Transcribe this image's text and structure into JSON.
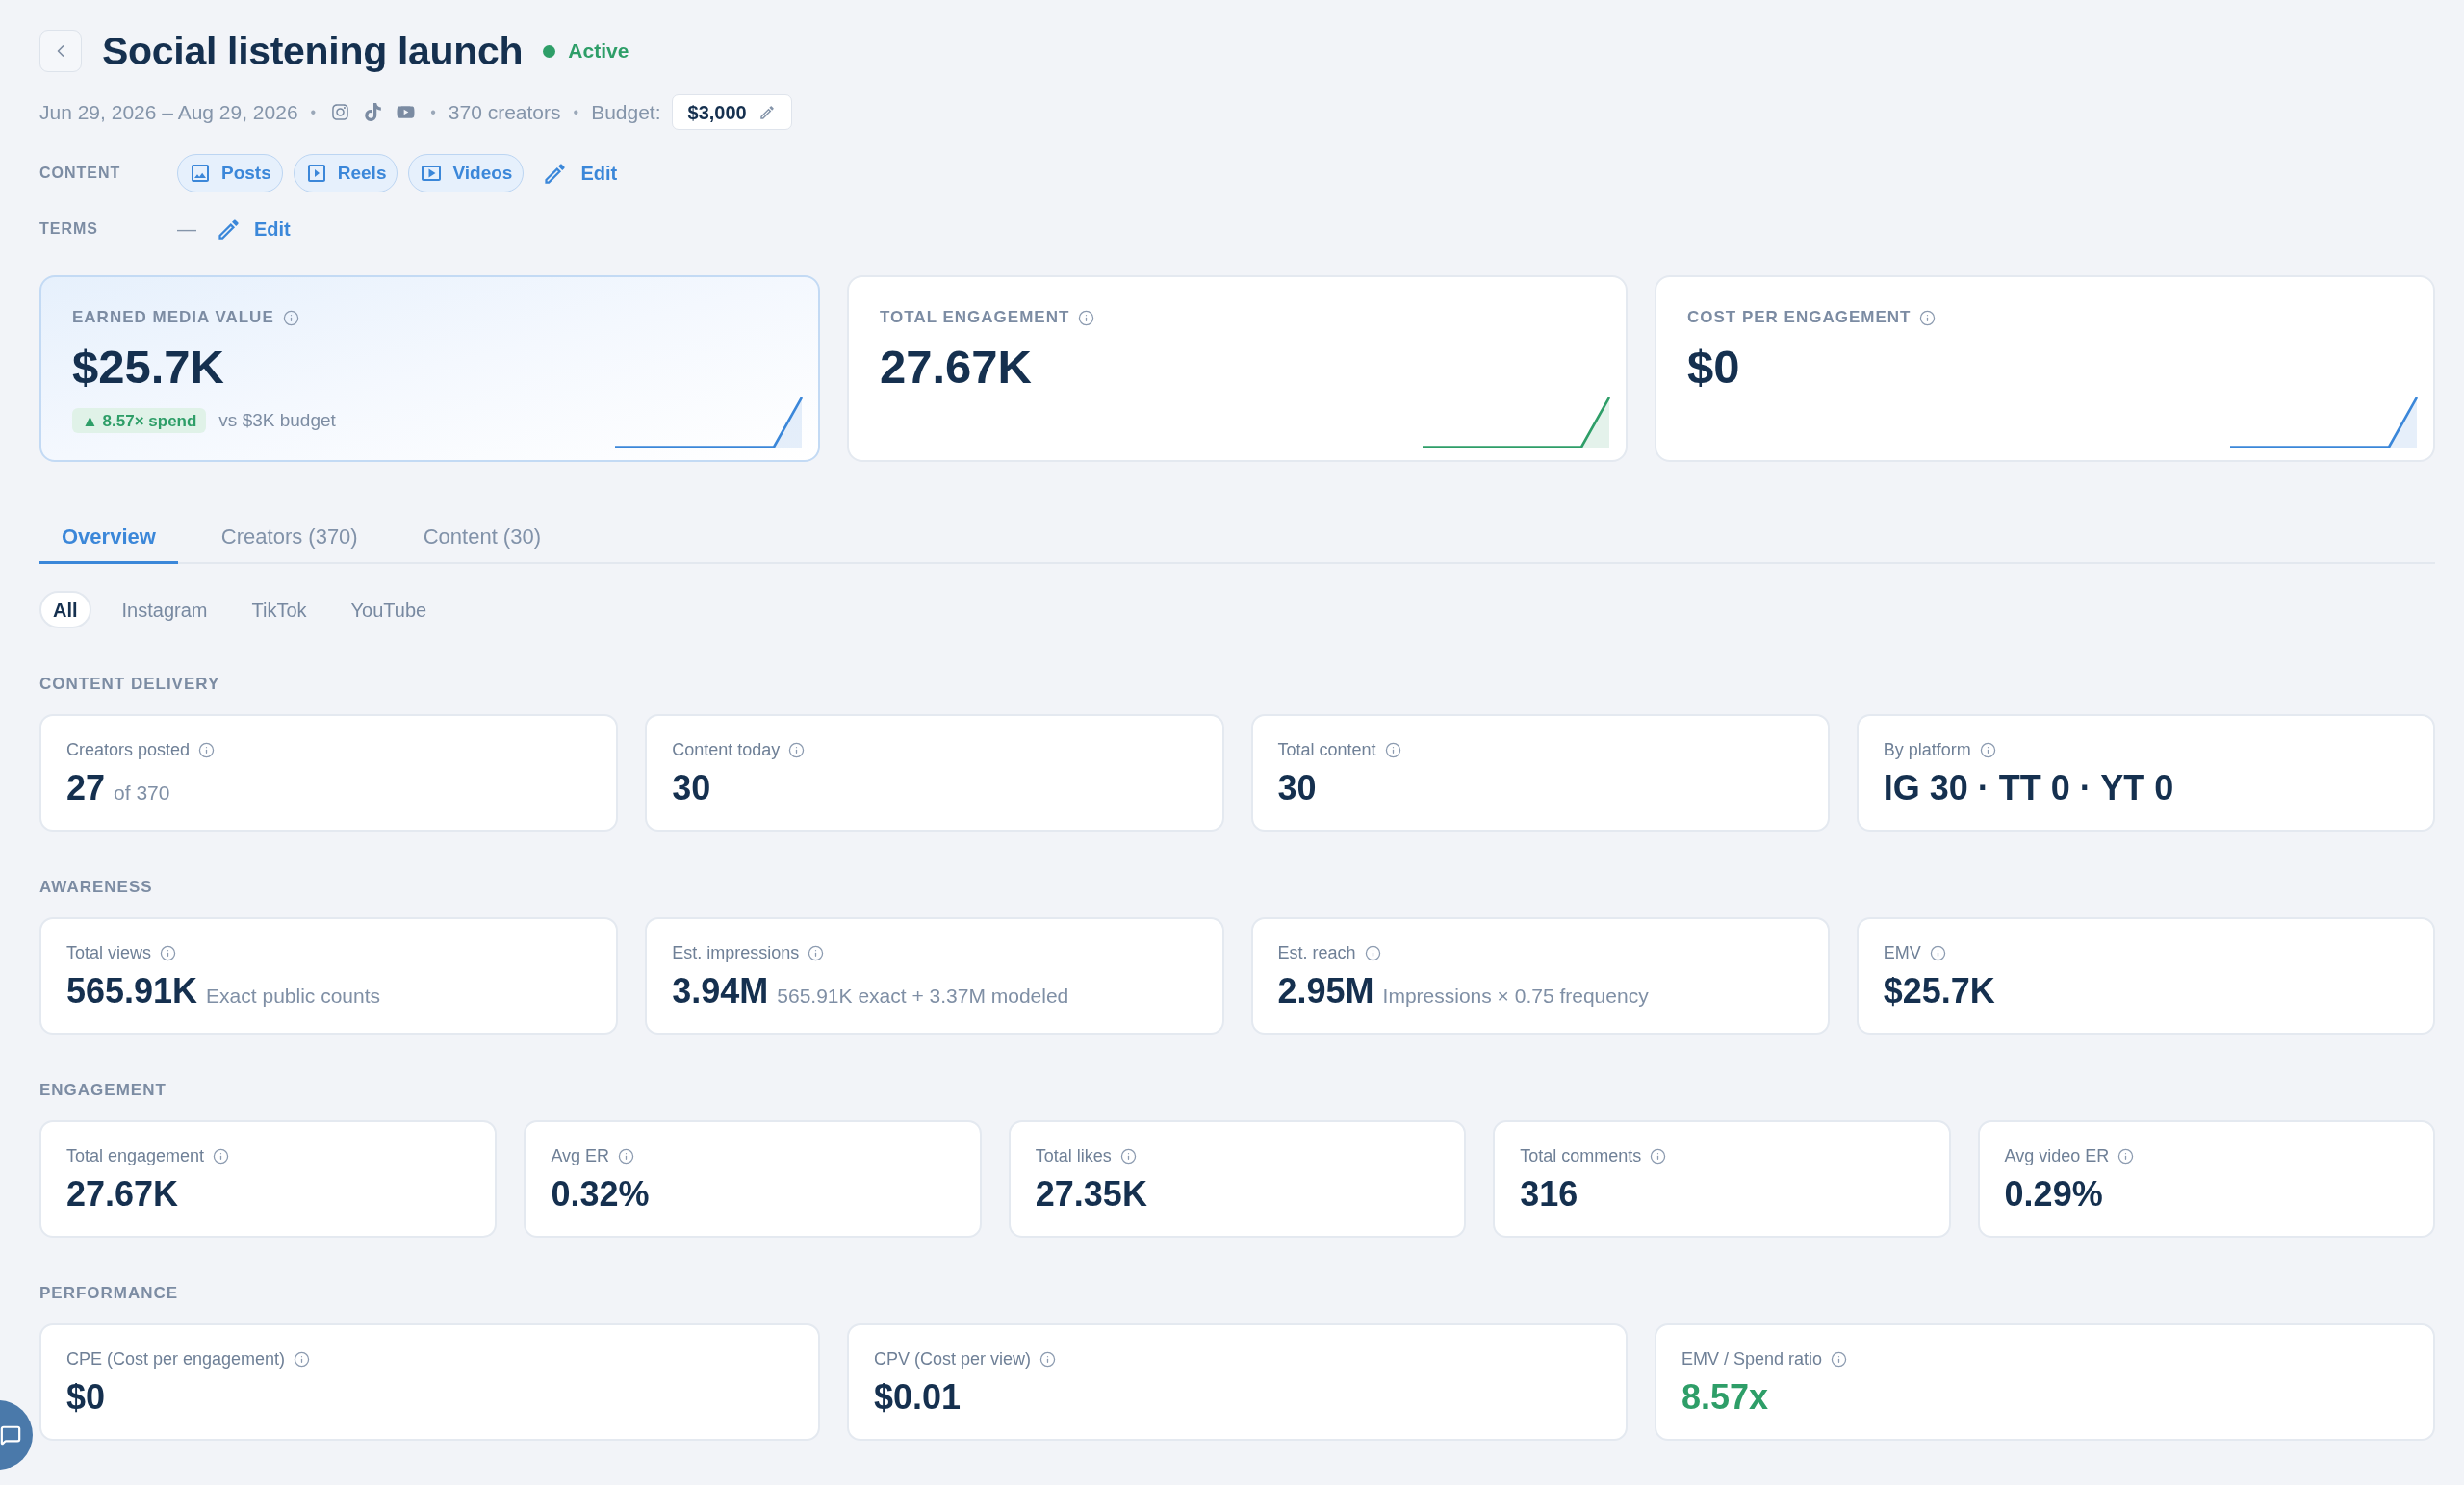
{
  "header": {
    "title": "Social listening launch",
    "status": {
      "kind": "active",
      "label": "Active"
    },
    "meta": [
      {
        "kind": "text",
        "text": "Jun 29, 2026 – Aug 29, 2026"
      },
      {
        "kind": "separator",
        "text": "•"
      },
      {
        "kind": "platforms",
        "platforms": [
          {
            "kind": "instagram"
          },
          {
            "kind": "tiktok"
          },
          {
            "kind": "youtube"
          }
        ]
      },
      {
        "kind": "separator",
        "text": "•"
      },
      {
        "kind": "text",
        "text": "370 creators"
      },
      {
        "kind": "separator",
        "text": "•"
      },
      {
        "kind": "budget",
        "label": "Budget:",
        "value": "$3,000"
      }
    ]
  },
  "content_row": {
    "label": "CONTENT",
    "chips": [
      {
        "kind": "image",
        "label": "Posts"
      },
      {
        "kind": "slideshow",
        "label": "Reels"
      },
      {
        "kind": "video",
        "label": "Videos"
      }
    ],
    "edit": "Edit"
  },
  "terms_row": {
    "label": "TERMS",
    "value": "—",
    "edit": "Edit"
  },
  "kpis": [
    {
      "label": "EARNED MEDIA VALUE",
      "value": "$25.7K",
      "highlighted": true,
      "color": "#3b87d9",
      "badge": "▲ 8.57× spend",
      "note": "vs $3K budget"
    },
    {
      "label": "TOTAL ENGAGEMENT",
      "value": "27.67K",
      "highlighted": false,
      "color": "#2e9e68"
    },
    {
      "label": "COST PER ENGAGEMENT",
      "value": "$0",
      "highlighted": false,
      "color": "#3b87d9"
    }
  ],
  "tabs": [
    {
      "label": "Overview",
      "selected": true
    },
    {
      "label": "Creators (370)",
      "selected": false
    },
    {
      "label": "Content (30)",
      "selected": false
    }
  ],
  "filters": [
    {
      "label": "All",
      "selected": true
    },
    {
      "label": "Instagram",
      "selected": false
    },
    {
      "label": "TikTok",
      "selected": false
    },
    {
      "label": "YouTube",
      "selected": false
    }
  ],
  "sections": [
    {
      "title": "CONTENT DELIVERY",
      "cards": [
        {
          "label": "Creators posted",
          "value": "27",
          "note": "of 370"
        },
        {
          "label": "Content today",
          "value": "30"
        },
        {
          "label": "Total content",
          "value": "30"
        },
        {
          "label": "By platform",
          "value": "IG 30 · TT 0 · YT 0"
        }
      ]
    },
    {
      "title": "AWARENESS",
      "cards": [
        {
          "label": "Total views",
          "value": "565.91K",
          "note": "Exact public counts"
        },
        {
          "label": "Est. impressions",
          "value": "3.94M",
          "note": "565.91K exact + 3.37M modeled"
        },
        {
          "label": "Est. reach",
          "value": "2.95M",
          "note": "Impressions × 0.75 frequency"
        },
        {
          "label": "EMV",
          "value": "$25.7K"
        }
      ]
    },
    {
      "title": "ENGAGEMENT",
      "cards": [
        {
          "label": "Total engagement",
          "value": "27.67K"
        },
        {
          "label": "Avg ER",
          "value": "0.32%"
        },
        {
          "label": "Total likes",
          "value": "27.35K"
        },
        {
          "label": "Total comments",
          "value": "316"
        },
        {
          "label": "Avg video ER",
          "value": "0.29%"
        }
      ]
    },
    {
      "title": "PERFORMANCE",
      "cards": [
        {
          "label": "CPE (Cost per engagement)",
          "value": "$0"
        },
        {
          "label": "CPV (Cost per view)",
          "value": "$0.01"
        },
        {
          "label": "EMV / Spend ratio",
          "value": "8.57x",
          "color": "#2e9e68"
        }
      ]
    }
  ]
}
